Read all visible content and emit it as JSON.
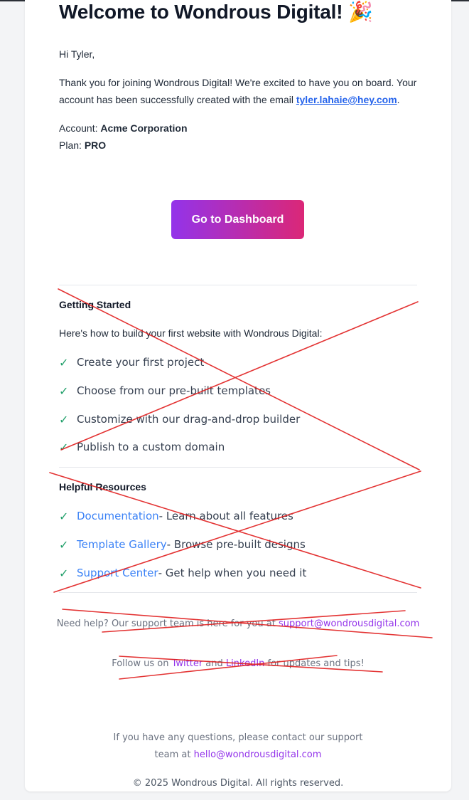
{
  "email": {
    "title": "Welcome to Wondrous Digital! 🎉",
    "greeting": "Hi Tyler,",
    "intro_text": "Thank you for joining Wondrous Digital! We're excited to have you on board. Your account has been successfully created with the email ",
    "intro_email": "tyler.lahaie@hey.com",
    "intro_end": ".",
    "account_label": "Account: ",
    "account_value": "Acme Corporation",
    "plan_label": "Plan: ",
    "plan_value": "PRO",
    "cta_label": "Go to Dashboard"
  },
  "getting_started": {
    "heading": "Getting Started",
    "subtitle": "Here's how to build your first website with Wondrous Digital:",
    "items": [
      "Create your first project",
      "Choose from our pre-built templates",
      "Customize with our drag-and-drop builder",
      "Publish to a custom domain"
    ]
  },
  "resources": {
    "heading": "Helpful Resources",
    "items": [
      {
        "link": "Documentation",
        "desc": " - Learn about all features"
      },
      {
        "link": "Template Gallery",
        "desc": " - Browse pre-built designs"
      },
      {
        "link": "Support Center",
        "desc": " - Get help when you need it"
      }
    ]
  },
  "footer": {
    "help_text": "Need help? Our support team is here for you at ",
    "help_email": "support@wondrousdigital.com",
    "follow_prefix": "Follow us on ",
    "twitter": "Twitter",
    "follow_and": " and ",
    "linkedin": "LinkedIn",
    "follow_suffix": " for updates and tips!",
    "questions_line1": "If you have any questions, please contact our support",
    "questions_prefix": "team at ",
    "questions_email": "hello@wondrousdigital.com",
    "copyright": "© 2025 Wondrous Digital. All rights reserved."
  },
  "check_icon": "✓",
  "colors": {
    "cta_gradient_start": "#9333ea",
    "cta_gradient_end": "#db2777",
    "check_green": "#22a06b",
    "link_blue": "#2563eb",
    "link_purple": "#9333ea",
    "annotation_red": "#e11d1d"
  }
}
